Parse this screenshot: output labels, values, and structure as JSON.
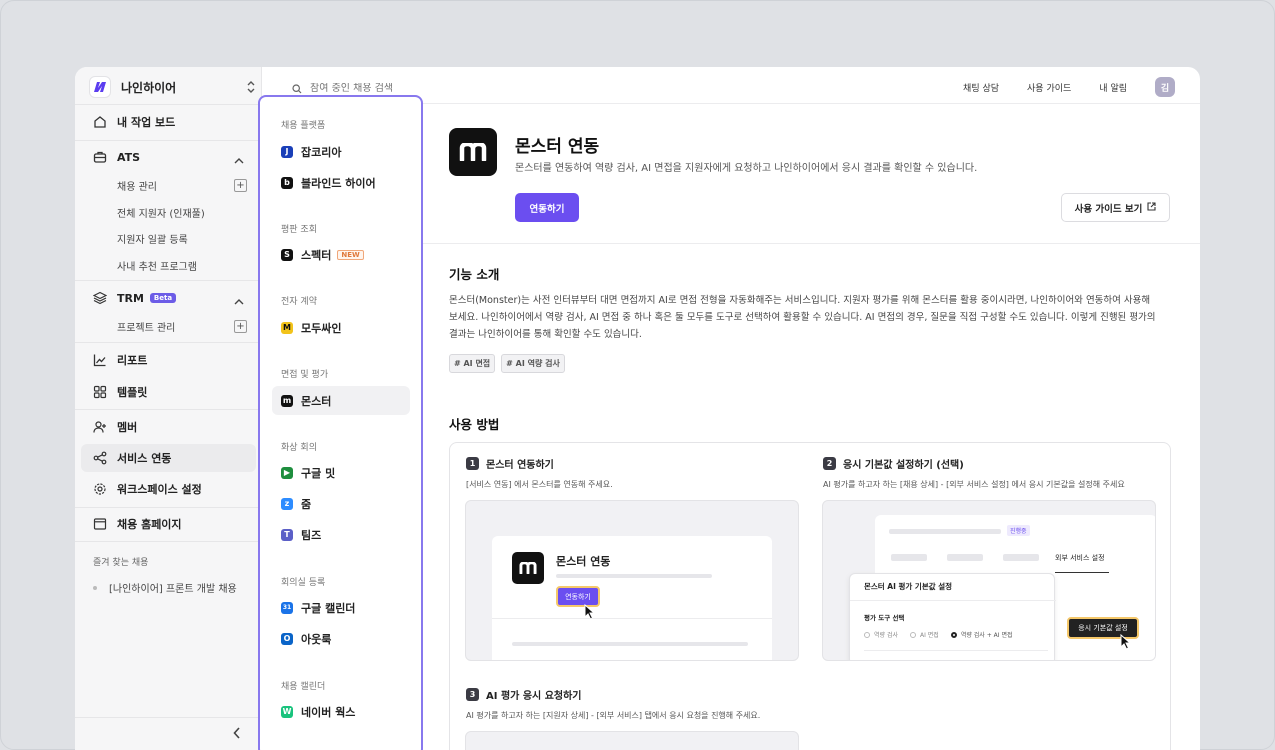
{
  "workspace": {
    "name": "나인하이어"
  },
  "sidebar": {
    "dashboard": "내 작업 보드",
    "ats": {
      "label": "ATS",
      "items": [
        "채용 관리",
        "전체 지원자 (인재풀)",
        "지원자 일괄 등록",
        "사내 추천 프로그램"
      ]
    },
    "trm": {
      "label": "TRM",
      "badge": "Beta",
      "items": [
        "프로젝트 관리"
      ]
    },
    "report": "리포트",
    "template": "템플릿",
    "member": "멤버",
    "integration": "서비스 연동",
    "workspace_settings": "워크스페이스 설정",
    "homepage": "채용 홈페이지",
    "favorites_title": "즐겨 찾는 채용",
    "favorites": [
      "[나인하이어] 프론트 개발 채용"
    ]
  },
  "topbar": {
    "search_placeholder": "참여 중인 채용 검색",
    "links": [
      "채팅 상담",
      "사용 가이드",
      "내 알림"
    ],
    "avatar": "김"
  },
  "popup": {
    "groups": [
      {
        "title": "채용 플랫폼",
        "items": [
          {
            "label": "잡코리아",
            "icon": "jobkorea-icon",
            "color": "#1a3fb8",
            "glyph": "J"
          },
          {
            "label": "블라인드 하이어",
            "icon": "blind-icon",
            "color": "#111111",
            "glyph": "b"
          }
        ]
      },
      {
        "title": "평판 조회",
        "items": [
          {
            "label": "스펙터",
            "icon": "specter-icon",
            "color": "#111111",
            "glyph": "S",
            "badge": "NEW"
          }
        ]
      },
      {
        "title": "전자 계약",
        "items": [
          {
            "label": "모두싸인",
            "icon": "modusign-icon",
            "color": "#f2c31b",
            "glyph": "M"
          }
        ]
      },
      {
        "title": "면접 및 평가",
        "items": [
          {
            "label": "몬스터",
            "icon": "monster-icon",
            "color": "#111111",
            "glyph": "m",
            "active": true
          }
        ]
      },
      {
        "title": "화상 회의",
        "items": [
          {
            "label": "구글 밋",
            "icon": "google-meet-icon",
            "color": "#1e8e3e",
            "glyph": "▶"
          },
          {
            "label": "줌",
            "icon": "zoom-icon",
            "color": "#2d8cff",
            "glyph": "z"
          },
          {
            "label": "팀즈",
            "icon": "teams-icon",
            "color": "#5b5fc7",
            "glyph": "T"
          }
        ]
      },
      {
        "title": "회의실 등록",
        "items": [
          {
            "label": "구글 캘린더",
            "icon": "google-calendar-icon",
            "color": "#1a73e8",
            "glyph": "31"
          },
          {
            "label": "아웃룩",
            "icon": "outlook-icon",
            "color": "#0a64c8",
            "glyph": "O"
          }
        ]
      },
      {
        "title": "채용 캘린더",
        "items": [
          {
            "label": "네이버 웍스",
            "icon": "naver-works-icon",
            "color": "#19c37d",
            "glyph": "W"
          }
        ]
      }
    ]
  },
  "main": {
    "title": "몬스터 연동",
    "description": "몬스터를 연동하여 역량 검사, AI 면접을 지원자에게 요청하고 나인하이어에서 응시 결과를 확인할 수 있습니다.",
    "connect_button": "연동하기",
    "guide_button": "사용 가이드 보기",
    "intro_title": "기능 소개",
    "intro_lines": [
      "몬스터(Monster)는 사전 인터뷰부터 대면 면접까지 AI로 면접 전형을 자동화해주는 서비스입니다. 지원자 평가를 위해 몬스터를 활용 중이시라면, 나인하이어와 연동하여 사용해",
      "보세요. 나인하이어에서 역량 검사, AI 면접 중 하나 혹은 둘 모두를 도구로 선택하여 활용할 수 있습니다. AI 면접의 경우, 질문을 직접 구성할 수도 있습니다. 이렇게 진행된 평가의",
      "결과는 나인하이어를 통해 확인할 수도 있습니다."
    ],
    "tags": [
      "# AI 면접",
      "# AI 역량 검사"
    ],
    "usage_title": "사용 방법",
    "steps": [
      {
        "num": "1",
        "title": "몬스터 연동하기",
        "desc": "[서비스 연동] 에서 몬스터를 연동해 주세요."
      },
      {
        "num": "2",
        "title": "응시 기본값 설정하기 (선택)",
        "desc": "AI 평가를 하고자 하는 [채용 상세] - [외부 서비스 설정] 에서 응시 기본값을 설정해 주세요"
      },
      {
        "num": "3",
        "title": "AI 평가 응시 요청하기",
        "desc": "AI 평가를 하고자 하는 [지원자 상세] - [외부 서비스] 탭에서 응시 요청을 진행해 주세요."
      }
    ],
    "illus1": {
      "title": "몬스터 연동",
      "button": "연동하기"
    },
    "illus2": {
      "status": "진행중",
      "tab": "외부 서비스 설정",
      "panel_title": "몬스터 AI 평가 기본값 설정",
      "tool_label": "평가 도구 선택",
      "options": [
        "역량 검사",
        "AI 면접",
        "역량 검사 + AI 면접"
      ],
      "button": "응시 기본값 설정"
    }
  },
  "colors": {
    "primary": "#6b4ef0",
    "popup_border": "#8878ee"
  }
}
